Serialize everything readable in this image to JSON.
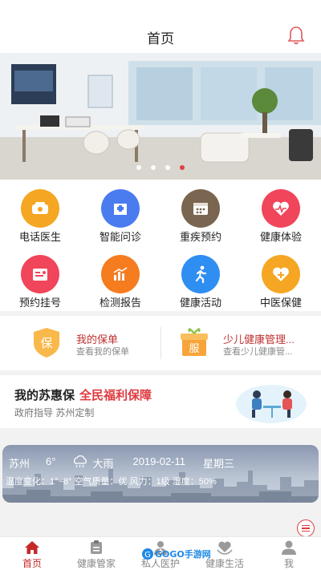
{
  "header": {
    "title": "首页",
    "bell_icon": "bell-icon"
  },
  "banner": {
    "slide_count": 4,
    "active_index": 3
  },
  "services": [
    {
      "label": "电话医生",
      "icon": "phone-icon",
      "color": "#f5a623"
    },
    {
      "label": "智能问诊",
      "icon": "hospital-icon",
      "color": "#4a7cf0"
    },
    {
      "label": "重疾预约",
      "icon": "calendar-icon",
      "color": "#7a6650"
    },
    {
      "label": "健康体验",
      "icon": "heartbeat-icon",
      "color": "#f0455a"
    },
    {
      "label": "预约挂号",
      "icon": "register-icon",
      "color": "#f0455a"
    },
    {
      "label": "检测报告",
      "icon": "report-chart-icon",
      "color": "#f57c1f"
    },
    {
      "label": "健康活动",
      "icon": "running-icon",
      "color": "#2f8ef2"
    },
    {
      "label": "中医保健",
      "icon": "heart-plus-icon",
      "color": "#f5a623"
    }
  ],
  "cards": [
    {
      "badge": "保",
      "title": "我的保单",
      "subtitle": "查看我的保单"
    },
    {
      "badge": "服",
      "title": "少儿健康管理...",
      "subtitle": "查看少儿健康管..."
    }
  ],
  "promo": {
    "title": "我的苏惠保",
    "highlight": "全民福利保障",
    "subtitle": "政府指导 苏州定制"
  },
  "weather": {
    "city": "苏州",
    "temp": "6°",
    "condition": "大雨",
    "date": "2019-02-11",
    "weekday": "星期三",
    "details": "温度变化：1°~8° 空气质量：优 风力：1级 湿度：50%"
  },
  "tabs": [
    {
      "label": "首页",
      "icon": "home-icon",
      "active": true
    },
    {
      "label": "健康管家",
      "icon": "clipboard-icon",
      "active": false
    },
    {
      "label": "私人医护",
      "icon": "doctor-icon",
      "active": false
    },
    {
      "label": "健康生活",
      "icon": "heart-hands-icon",
      "active": false
    },
    {
      "label": "我",
      "icon": "user-icon",
      "active": false
    }
  ],
  "watermark": "GOGO手游网"
}
